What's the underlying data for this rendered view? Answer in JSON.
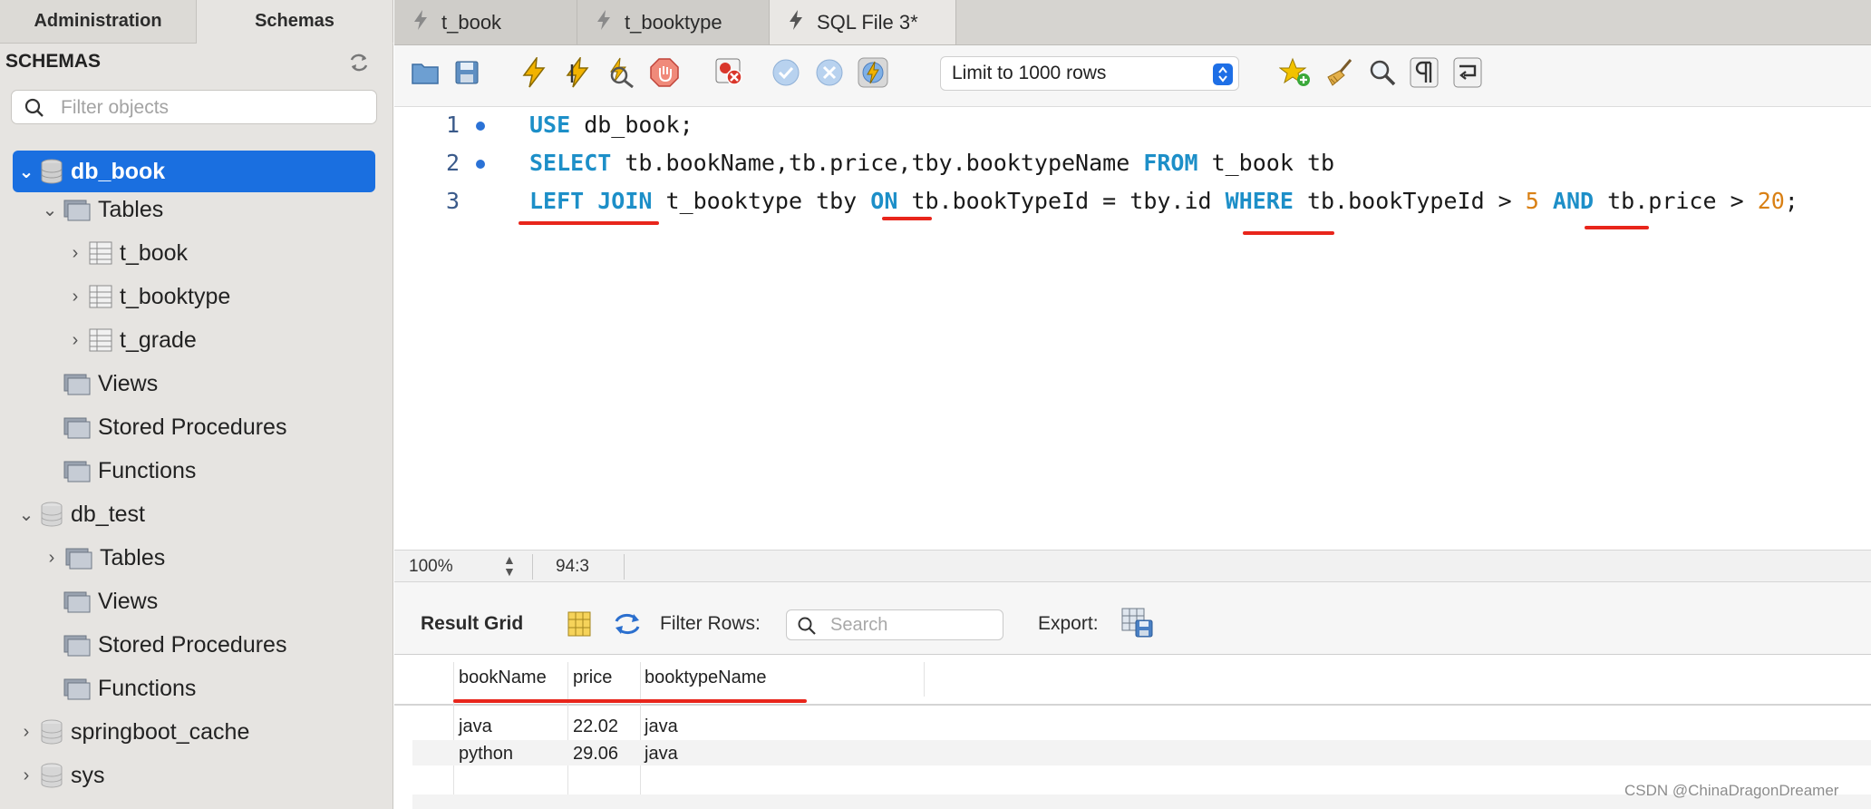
{
  "sidebar": {
    "tabs": [
      {
        "label": "Administration",
        "active": false
      },
      {
        "label": "Schemas",
        "active": true
      }
    ],
    "heading": "SCHEMAS",
    "filter_placeholder": "Filter objects",
    "tree": {
      "db_book": "db_book",
      "tables": "Tables",
      "t_book": "t_book",
      "t_booktype": "t_booktype",
      "t_grade": "t_grade",
      "views": "Views",
      "stored_procedures": "Stored Procedures",
      "functions": "Functions",
      "db_test": "db_test",
      "springboot_cache": "springboot_cache",
      "sys": "sys"
    }
  },
  "editor_tabs": [
    {
      "label": "t_book",
      "active": false
    },
    {
      "label": "t_booktype",
      "active": false
    },
    {
      "label": "SQL File 3*",
      "active": true
    }
  ],
  "toolbar": {
    "limit_label": "Limit to 1000 rows"
  },
  "editor": {
    "line_numbers": [
      "1",
      "2",
      "3"
    ],
    "tokens": {
      "use": "USE",
      "db_book_semicolon": " db_book;",
      "select": "SELECT",
      "select_cols": " tb.bookName,tb.price,tby.booktypeName ",
      "from": "FROM",
      "from_tables": " t_book tb",
      "left_join": "LEFT JOIN",
      "join_table": " t_booktype tby ",
      "on": "ON",
      "on_cond": " tb.bookTypeId = tby.id ",
      "where": "WHERE",
      "where_cond": " tb.bookTypeId > ",
      "five": "5",
      "and": "AND",
      "price_cond": " tb.price > ",
      "twenty": "20",
      "end": ";"
    },
    "colors": {
      "keyword": "#1d8fc8",
      "number": "#d98014",
      "annotation": "#e8251b"
    }
  },
  "status": {
    "zoom": "100%",
    "cursor": "94:3"
  },
  "result": {
    "title": "Result Grid",
    "filter_label": "Filter Rows:",
    "search_placeholder": "Search",
    "export_label": "Export:",
    "columns": [
      "bookName",
      "price",
      "booktypeName"
    ],
    "rows": [
      [
        "java",
        "22.02",
        "java"
      ],
      [
        "python",
        "29.06",
        "java"
      ]
    ]
  },
  "watermark": "CSDN @ChinaDragonDreamer"
}
